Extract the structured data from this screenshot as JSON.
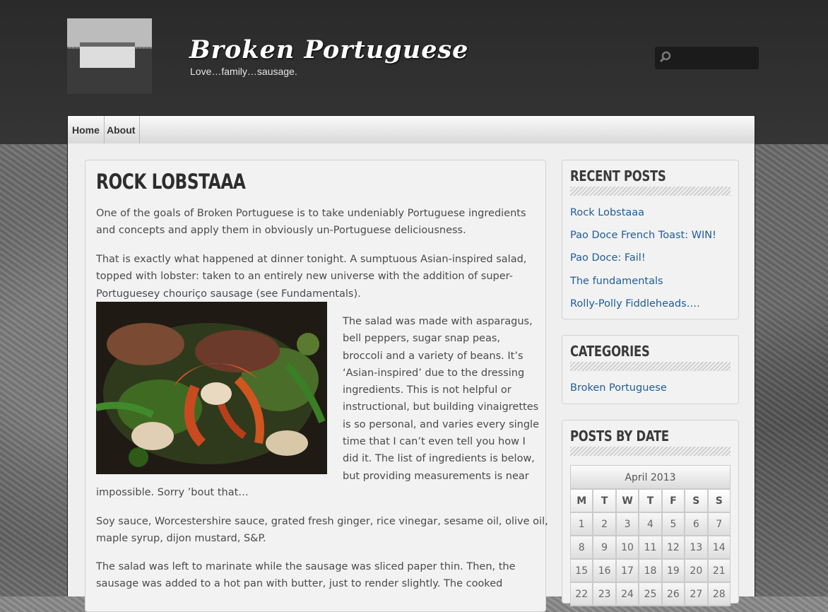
{
  "site": {
    "title": "Broken Portuguese",
    "tagline": "Love…family…sausage."
  },
  "search": {
    "placeholder": ""
  },
  "nav": {
    "items": [
      {
        "label": "Home"
      },
      {
        "label": "About"
      }
    ]
  },
  "post": {
    "title": "ROCK LOBSTAAA",
    "paragraph1": [
      "One of the goals of Broken Portuguese is to take undeniably Portuguese ingredients",
      "and concepts and apply them in obviously un-Portuguese deliciousness."
    ],
    "paragraph2": [
      "That is exactly what happened at dinner tonight.  A sumptuous Asian-inspired salad,",
      "topped with lobster: taken to an entirely new universe with the addition of super-",
      "Portuguesey chouriço sausage (see Fundamentals)."
    ],
    "paragraph3_wrapped": [
      "The salad was made with asparagus,",
      "bell peppers, sugar snap peas,",
      "broccoli and a variety of beans.  It’s",
      "‘Asian-inspired’ due to the dressing",
      "ingredients.  This is not helpful or",
      "instructional, but building vinaigrettes",
      "is so personal, and varies every single",
      "time that I can’t even tell you how I",
      "did it.  The list of ingredients is below,",
      "but providing measurements is near"
    ],
    "paragraph3_tail": "impossible.  Sorry ’bout that…",
    "paragraph4": [
      "Soy sauce, Worcestershire sauce, grated fresh ginger, rice vinegar, sesame oil, olive oil,",
      "maple syrup, dijon mustard, S&P."
    ],
    "paragraph5": [
      "The salad was left to marinate while the sausage was sliced paper thin.  Then, the",
      "sausage was added to a hot pan with butter, just to render slightly.  The cooked"
    ]
  },
  "sidebar": {
    "recent_posts": {
      "title": "RECENT POSTS",
      "items": [
        "Rock Lobstaaa",
        "Pao Doce French Toast: WIN!",
        "Pao Doce: Fail!",
        "The fundamentals",
        "Rolly-Polly Fiddleheads…."
      ]
    },
    "categories": {
      "title": "CATEGORIES",
      "items": [
        "Broken Portuguese"
      ]
    },
    "posts_by_date": {
      "title": "POSTS BY DATE",
      "calendar": {
        "caption": "April 2013",
        "weekdays": [
          "M",
          "T",
          "W",
          "T",
          "F",
          "S",
          "S"
        ],
        "weeks": [
          [
            "1",
            "2",
            "3",
            "4",
            "5",
            "6",
            "7"
          ],
          [
            "8",
            "9",
            "10",
            "11",
            "12",
            "13",
            "14"
          ],
          [
            "15",
            "16",
            "17",
            "18",
            "19",
            "20",
            "21"
          ],
          [
            "22",
            "23",
            "24",
            "25",
            "26",
            "27",
            "28"
          ]
        ]
      }
    }
  },
  "colors": {
    "header_bg": "#2f2f2f",
    "link": "#1f5c99",
    "text": "#4a4a4a"
  }
}
